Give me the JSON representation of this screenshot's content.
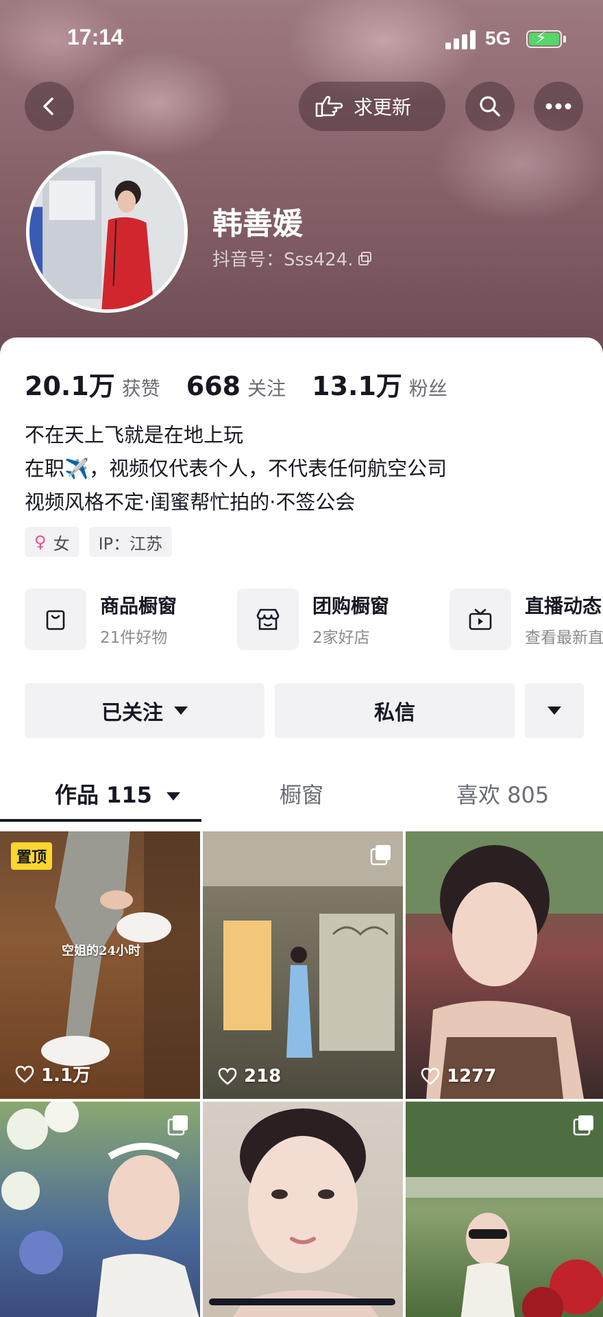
{
  "status_bar": {
    "time": "17:14",
    "network": "5G"
  },
  "header": {
    "request_update_label": "求更新",
    "back_icon": "chevron-left-icon",
    "search_icon": "search-icon",
    "more_icon": "more-dots-icon"
  },
  "profile": {
    "name": "韩善媛",
    "douyin_id": "抖音号：Sss424."
  },
  "stats": [
    {
      "value": "20.1万",
      "label": "获赞"
    },
    {
      "value": "668",
      "label": "关注"
    },
    {
      "value": "13.1万",
      "label": "粉丝"
    }
  ],
  "bio": [
    "不在天上飞就是在地上玩",
    "在职✈️，视频仅代表个人，不代表任何航空公司",
    "视频风格不定·闺蜜帮忙拍的·不签公会"
  ],
  "tags": {
    "gender": "女",
    "ip": "IP：江苏"
  },
  "services": [
    {
      "title": "商品橱窗",
      "sub": "21件好物",
      "icon": "shopping-bag-icon"
    },
    {
      "title": "团购橱窗",
      "sub": "2家好店",
      "icon": "store-icon"
    },
    {
      "title": "直播动态",
      "sub": "查看最新直",
      "icon": "tv-icon"
    }
  ],
  "actions": {
    "follow_label": "已关注",
    "message_label": "私信"
  },
  "tabs": [
    {
      "label": "作品 115"
    },
    {
      "label": "橱窗"
    },
    {
      "label": "喜欢 805"
    }
  ],
  "videos": [
    {
      "likes": "1.1万",
      "pinned": "置顶",
      "caption": "空姐的24小时"
    },
    {
      "likes": "218"
    },
    {
      "likes": "1277"
    },
    {
      "likes": ""
    },
    {
      "likes": ""
    },
    {
      "likes": ""
    }
  ],
  "colors": {
    "pin_badge": "#fcd530",
    "gender_pink": "#ef4b8f",
    "header_tint": "#8a646b"
  }
}
